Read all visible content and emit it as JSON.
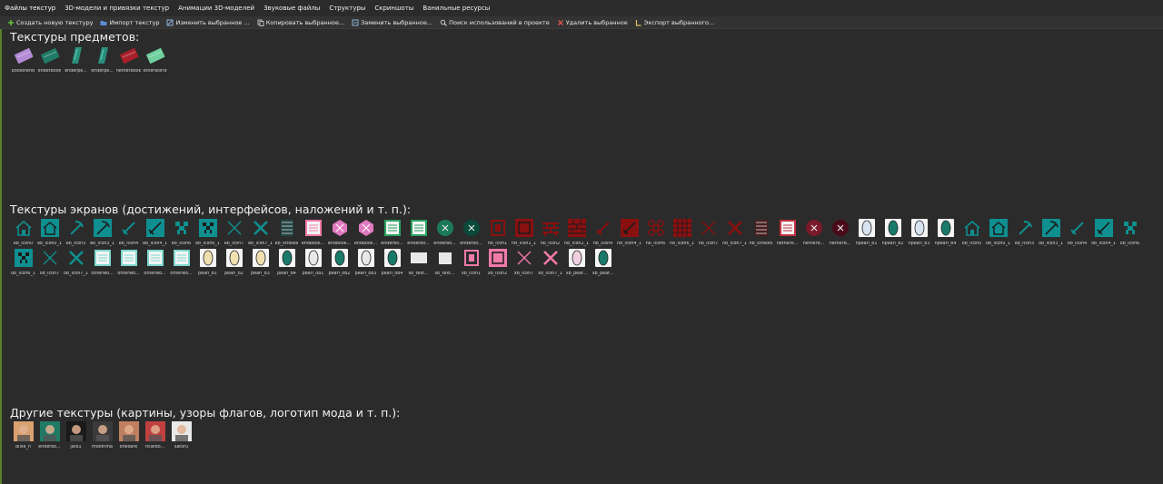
{
  "tabs": [
    "Файлы текстур",
    "3D-модели и привязки текстур",
    "Анимации 3D-моделей",
    "Звуковые файлы",
    "Структуры",
    "Скриншоты",
    "Ванильные ресурсы"
  ],
  "toolbar": [
    {
      "label": "Создать новую текстуру",
      "icon": "plus-icon",
      "color": "#5fbf3a"
    },
    {
      "label": "Импорт текстур",
      "icon": "folder-icon",
      "color": "#5b8ed6"
    },
    {
      "label": "Изменить выбранное ...",
      "icon": "edit-icon",
      "color": "#8fb3d9"
    },
    {
      "label": "Копировать выбранное...",
      "icon": "copy-icon",
      "color": "#bdbdbd"
    },
    {
      "label": "Заменить выбранное...",
      "icon": "replace-icon",
      "color": "#8fb3d9"
    },
    {
      "label": "Поиск использований в проекте",
      "icon": "search-icon",
      "color": "#d0d0d0"
    },
    {
      "label": "Удалить выбранное",
      "icon": "delete-icon",
      "color": "#e05252"
    },
    {
      "label": "Экспорт выбранного...",
      "icon": "export-icon",
      "color": "#e0c060"
    }
  ],
  "sections": [
    {
      "title": "Текстуры предметов:",
      "items": [
        {
          "name": "bookofend",
          "kind": "book",
          "color": "#b48ad6"
        },
        {
          "name": "enderbook",
          "kind": "book",
          "color": "#1f7a66"
        },
        {
          "name": "enderpe...",
          "kind": "gem",
          "color": "#2a8f7a"
        },
        {
          "name": "enderpe...",
          "kind": "gem",
          "color": "#2a8f7a"
        },
        {
          "name": "netherbook",
          "kind": "book",
          "color": "#a8202a"
        },
        {
          "name": "otherworld",
          "kind": "book",
          "color": "#6fcf9f"
        }
      ]
    },
    {
      "title": "Текстуры экранов (достижений, интерфейсов, наложений и т. п.):",
      "items": [
        {
          "name": "eb_icon0",
          "kind": "house",
          "color": "#0f8f8f"
        },
        {
          "name": "eb_icon0_1",
          "kind": "housebox",
          "color": "#0f8f8f"
        },
        {
          "name": "eb_icon3",
          "kind": "pick",
          "color": "#0f8f8f"
        },
        {
          "name": "eb_icon3_1",
          "kind": "pickbox",
          "color": "#0f8f8f"
        },
        {
          "name": "eb_icon4",
          "kind": "sword",
          "color": "#0f8f8f"
        },
        {
          "name": "eb_icon4_1",
          "kind": "swordbox",
          "color": "#0f8f8f"
        },
        {
          "name": "eb_icon6",
          "kind": "creeper",
          "color": "#0f8f8f"
        },
        {
          "name": "eb_icon6_1",
          "kind": "creeperbox",
          "color": "#0f8f8f"
        },
        {
          "name": "eb_icon7",
          "kind": "xthin",
          "color": "#0f8f8f"
        },
        {
          "name": "eb_icon7_1",
          "kind": "x",
          "color": "#0f8f8f"
        },
        {
          "name": "eb_strokes",
          "kind": "strokes",
          "color": "#1a6060"
        },
        {
          "name": "endbook...",
          "kind": "page",
          "color": "#f07aa8"
        },
        {
          "name": "endbook...",
          "kind": "hex",
          "color": "#e07ac0"
        },
        {
          "name": "endbook...",
          "kind": "hex",
          "color": "#e07ac0"
        },
        {
          "name": "enderbo...",
          "kind": "page",
          "color": "#2aa060"
        },
        {
          "name": "enderbo...",
          "kind": "page",
          "color": "#2aa060"
        },
        {
          "name": "enderbo...",
          "kind": "circlex",
          "color": "#1a7a5a"
        },
        {
          "name": "enderbo...",
          "kind": "circlex",
          "color": "#0a4a3a"
        },
        {
          "name": "nb_icon1",
          "kind": "frame",
          "color": "#8a1010"
        },
        {
          "name": "nb_icon1_1",
          "kind": "framebox",
          "color": "#8a1010"
        },
        {
          "name": "nb_icon2",
          "kind": "bricks",
          "color": "#8a1010"
        },
        {
          "name": "nb_icon2_1",
          "kind": "bricksbox",
          "color": "#8a1010"
        },
        {
          "name": "nb_icon4",
          "kind": "sword",
          "color": "#8a1010"
        },
        {
          "name": "nb_icon4_1",
          "kind": "swordbox",
          "color": "#8a1010"
        },
        {
          "name": "nb_icon6",
          "kind": "grid",
          "color": "#8a1010"
        },
        {
          "name": "nb_icon6_1",
          "kind": "gridbox",
          "color": "#8a1010"
        },
        {
          "name": "nb_icon7",
          "kind": "xthin",
          "color": "#8a1010"
        },
        {
          "name": "nb_icon7_1",
          "kind": "x",
          "color": "#8a1010"
        },
        {
          "name": "nb_strokes",
          "kind": "strokes",
          "color": "#6a1010"
        },
        {
          "name": "netherb...",
          "kind": "page",
          "color": "#c03040"
        },
        {
          "name": "netherb...",
          "kind": "circlex",
          "color": "#7a1a2a"
        },
        {
          "name": "netherb...",
          "kind": "circlex",
          "color": "#4a0a1a"
        },
        {
          "name": "npearl_b1",
          "kind": "pearl",
          "color": "#d8e4f0"
        },
        {
          "name": "npearl_b2",
          "kind": "pearl",
          "color": "#1a7a6a"
        },
        {
          "name": "npearl_b3",
          "kind": "pearl",
          "color": "#d8e4f0"
        },
        {
          "name": "npearl_b4",
          "kind": "pearl",
          "color": "#1a7a6a"
        },
        {
          "name": "ob_icon0",
          "kind": "house",
          "color": "#0f8f8f"
        },
        {
          "name": "ob_icon0_1",
          "kind": "housebox",
          "color": "#0f8f8f"
        },
        {
          "name": "ob_icon3",
          "kind": "pick",
          "color": "#0f8f8f"
        },
        {
          "name": "ob_icon3_1",
          "kind": "pickbox",
          "color": "#0f8f8f"
        },
        {
          "name": "ob_icon4",
          "kind": "sword",
          "color": "#0f8f8f"
        },
        {
          "name": "ob_icon4_1",
          "kind": "swordbox",
          "color": "#0f8f8f"
        },
        {
          "name": "ob_icon6",
          "kind": "creeper",
          "color": "#0f8f8f"
        },
        {
          "name": "ob_icon6_1",
          "kind": "creeperbox",
          "color": "#0f8f8f"
        },
        {
          "name": "ob_icon7",
          "kind": "xthin",
          "color": "#0f8f8f"
        },
        {
          "name": "ob_icon7_1",
          "kind": "x",
          "color": "#0f8f8f"
        },
        {
          "name": "otherwo...",
          "kind": "page",
          "color": "#7fd8d0"
        },
        {
          "name": "otherwo...",
          "kind": "page",
          "color": "#7fd8d0"
        },
        {
          "name": "otherwo...",
          "kind": "page",
          "color": "#7fd8d0"
        },
        {
          "name": "otherwo...",
          "kind": "page",
          "color": "#7fd8d0"
        },
        {
          "name": "pearl_b1",
          "kind": "pearl",
          "color": "#f0e0b0"
        },
        {
          "name": "pearl_b2",
          "kind": "pearl",
          "color": "#f0e0b0"
        },
        {
          "name": "pearl_b3",
          "kind": "pearl",
          "color": "#f0e0b0"
        },
        {
          "name": "pearl_b4",
          "kind": "pearl",
          "color": "#1a7a6a"
        },
        {
          "name": "pearl_ob1",
          "kind": "pearl",
          "color": "#e8e8e8"
        },
        {
          "name": "pearl_ob2",
          "kind": "pearl",
          "color": "#1a7a6a"
        },
        {
          "name": "pearl_ob3",
          "kind": "pearl",
          "color": "#e8e8e8"
        },
        {
          "name": "pearl_ob4",
          "kind": "pearl",
          "color": "#1a7a6a"
        },
        {
          "name": "sb_text...",
          "kind": "plain",
          "color": "#e8e8e8"
        },
        {
          "name": "sb_text...",
          "kind": "plainsmall",
          "color": "#e8e8e8"
        },
        {
          "name": "xb_icon1",
          "kind": "frame",
          "color": "#f07aa8"
        },
        {
          "name": "xb_icon2",
          "kind": "framebox",
          "color": "#f07aa8"
        },
        {
          "name": "xb_icon7",
          "kind": "xthin",
          "color": "#f07aa8"
        },
        {
          "name": "xb_icon7_1",
          "kind": "x",
          "color": "#f07aa8"
        },
        {
          "name": "xb_pear...",
          "kind": "pearl",
          "color": "#f0d0e0"
        },
        {
          "name": "xb_pear...",
          "kind": "pearl",
          "color": "#1a7a6a"
        }
      ]
    },
    {
      "title": "Другие текстуры (картины, узоры флагов, логотип мода и т. п.):",
      "items": [
        {
          "name": "billie_h",
          "kind": "photo",
          "color": "#d9a070"
        },
        {
          "name": "enderbo...",
          "kind": "photo",
          "color": "#1f7a66"
        },
        {
          "name": "jato1",
          "kind": "photo",
          "color": "#1a1a1a"
        },
        {
          "name": "midorima",
          "kind": "photo",
          "color": "#3a3a3a"
        },
        {
          "name": "onedark",
          "kind": "photo",
          "color": "#c08060"
        },
        {
          "name": "ricardo...",
          "kind": "photo",
          "color": "#c04040"
        },
        {
          "name": "satoru",
          "kind": "photo",
          "color": "#e8e8e8"
        }
      ]
    }
  ]
}
